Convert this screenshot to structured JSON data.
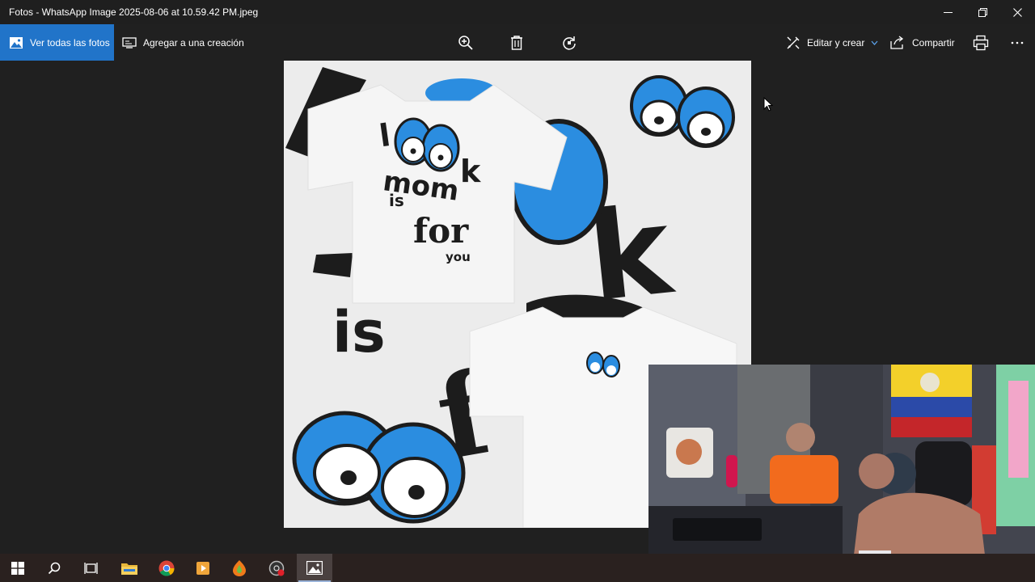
{
  "window": {
    "title": "Fotos - WhatsApp Image 2025-08-06 at 10.59.42 PM.jpeg"
  },
  "toolbar": {
    "see_all_label": "Ver todas las fotos",
    "add_to_creation_label": "Agregar a una creación",
    "edit_create_label": "Editar y crear",
    "share_label": "Compartir"
  },
  "photo": {
    "shirt_text": [
      "l",
      "k",
      "mom",
      "is",
      "for",
      "you"
    ],
    "background_text": [
      "k",
      "is",
      "f"
    ]
  },
  "colors": {
    "accent": "#2174c9",
    "titlebar": "#1f1f1f",
    "viewer_bg": "#202020",
    "taskbar": "#2a211f",
    "eye_blue": "#2b8de0"
  },
  "taskbar_icons": [
    "windows-start-icon",
    "search-icon",
    "task-view-icon",
    "file-explorer-icon",
    "chrome-icon",
    "media-player-icon",
    "fl-studio-icon",
    "recorder-icon",
    "photos-icon"
  ]
}
